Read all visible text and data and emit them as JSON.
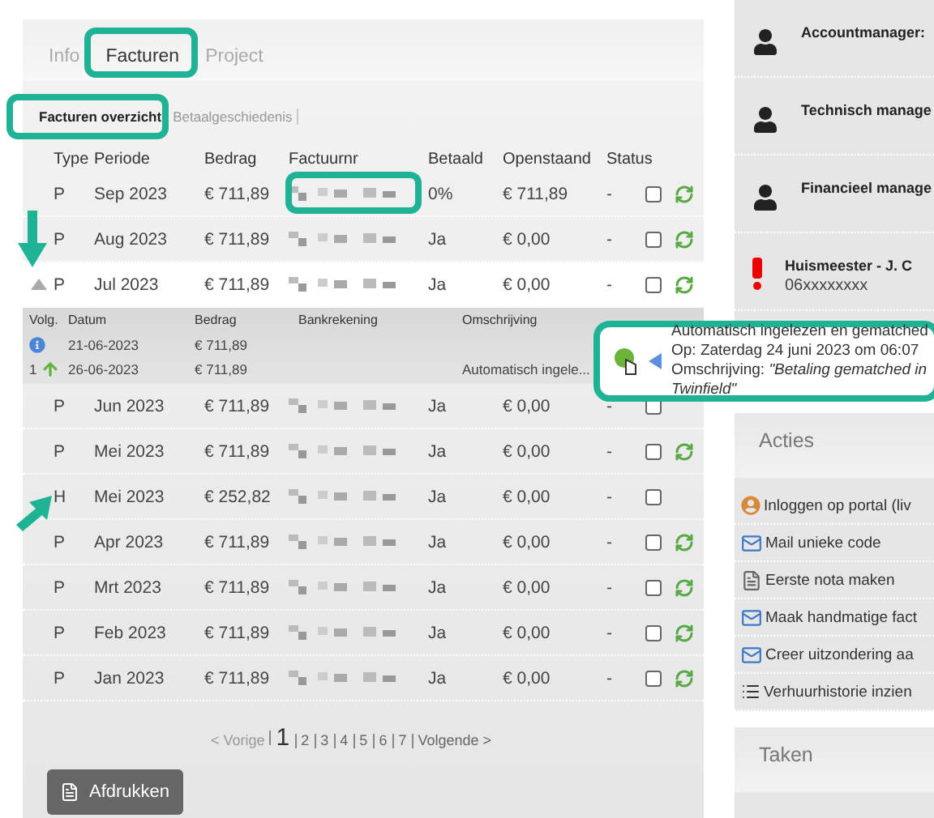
{
  "tabs": [
    {
      "label": "Info",
      "selected": false
    },
    {
      "label": "Facturen",
      "selected": true
    },
    {
      "label": "Project",
      "selected": false
    }
  ],
  "subtabs": [
    {
      "label": "Facturen overzicht",
      "selected": true
    },
    {
      "label": "Betaalgeschiedenis",
      "selected": false
    }
  ],
  "invoices": {
    "columns": [
      "Type",
      "Periode",
      "Bedrag",
      "Factuurnr",
      "Betaald",
      "Openstaand",
      "Status"
    ],
    "rows": [
      {
        "type": "P",
        "periode": "Sep 2023",
        "bedrag": "€ 711,89",
        "betaald": "0%",
        "openstaand": "€ 711,89",
        "status": "-",
        "checked": false,
        "sync": true,
        "expanded": false
      },
      {
        "type": "P",
        "periode": "Aug 2023",
        "bedrag": "€ 711,89",
        "betaald": "Ja",
        "openstaand": "€ 0,00",
        "status": "-",
        "checked": false,
        "sync": true,
        "expanded": false
      },
      {
        "type": "P",
        "periode": "Jul 2023",
        "bedrag": "€ 711,89",
        "betaald": "Ja",
        "openstaand": "€ 0,00",
        "status": "-",
        "checked": false,
        "sync": true,
        "expanded": true,
        "payments": {
          "columns": [
            "Volg.",
            "Datum",
            "Bedrag",
            "Bankrekening",
            "Omschrijving"
          ],
          "rows": [
            {
              "kind": "info",
              "datum": "21-06-2023",
              "bedrag": "€ 711,89"
            },
            {
              "kind": "payment",
              "volg": "1",
              "datum": "26-06-2023",
              "bedrag": "€ 711,89",
              "omschrijving": "Automatisch ingele..."
            }
          ]
        }
      },
      {
        "type": "P",
        "periode": "Jun 2023",
        "bedrag": "€ 711,89",
        "betaald": "Ja",
        "openstaand": "€ 0,00",
        "status": "-",
        "checked": false,
        "sync": false,
        "expanded": false
      },
      {
        "type": "P",
        "periode": "Mei 2023",
        "bedrag": "€ 711,89",
        "betaald": "Ja",
        "openstaand": "€ 0,00",
        "status": "-",
        "checked": false,
        "sync": true,
        "expanded": false
      },
      {
        "type": "H",
        "periode": "Mei 2023",
        "bedrag": "€ 252,82",
        "betaald": "Ja",
        "openstaand": "€ 0,00",
        "status": "-",
        "checked": false,
        "sync": false,
        "expanded": false
      },
      {
        "type": "P",
        "periode": "Apr 2023",
        "bedrag": "€ 711,89",
        "betaald": "Ja",
        "openstaand": "€ 0,00",
        "status": "-",
        "checked": false,
        "sync": true,
        "expanded": false
      },
      {
        "type": "P",
        "periode": "Mrt 2023",
        "bedrag": "€ 711,89",
        "betaald": "Ja",
        "openstaand": "€ 0,00",
        "status": "-",
        "checked": false,
        "sync": true,
        "expanded": false
      },
      {
        "type": "P",
        "periode": "Feb 2023",
        "bedrag": "€ 711,89",
        "betaald": "Ja",
        "openstaand": "€ 0,00",
        "status": "-",
        "checked": false,
        "sync": true,
        "expanded": false
      },
      {
        "type": "P",
        "periode": "Jan 2023",
        "bedrag": "€ 711,89",
        "betaald": "Ja",
        "openstaand": "€ 0,00",
        "status": "-",
        "checked": false,
        "sync": true,
        "expanded": false
      }
    ]
  },
  "pagination": {
    "previous": "< Vorige",
    "next": "Volgende >",
    "pages": [
      {
        "label": "1",
        "selected": true
      },
      {
        "label": "2",
        "selected": false
      },
      {
        "label": "3",
        "selected": false
      },
      {
        "label": "4",
        "selected": false
      },
      {
        "label": "5",
        "selected": false
      },
      {
        "label": "6",
        "selected": false
      },
      {
        "label": "7",
        "selected": false
      }
    ]
  },
  "print_button": "Afdrukken",
  "tooltip": {
    "lines": [
      "Automatisch ingelezen en gematched",
      "Op: Zaterdag 24 juni 2023 om 06:07",
      "Omschrijving: *\"Betaling gematched in Twinfield\"*"
    ]
  },
  "contacts": [
    {
      "kind": "person",
      "label": "Accountmanager:"
    },
    {
      "kind": "person",
      "label": "Technisch manage"
    },
    {
      "kind": "person",
      "label": "Financieel manage"
    },
    {
      "kind": "alert",
      "label": "Huismeester - J. C",
      "phone": "06xxxxxxxx"
    }
  ],
  "actions": {
    "title": "Acties",
    "items": [
      {
        "kind": "login",
        "label": "Inloggen op portal (liv"
      },
      {
        "kind": "mail",
        "label": "Mail unieke code"
      },
      {
        "kind": "document",
        "label": "Eerste nota maken"
      },
      {
        "kind": "mail",
        "label": "Maak handmatige fact"
      },
      {
        "kind": "mail",
        "label": "Creer uitzondering aa"
      },
      {
        "kind": "list",
        "label": "Verhuurhistorie inzien"
      }
    ]
  },
  "tasks": {
    "title": "Taken"
  }
}
